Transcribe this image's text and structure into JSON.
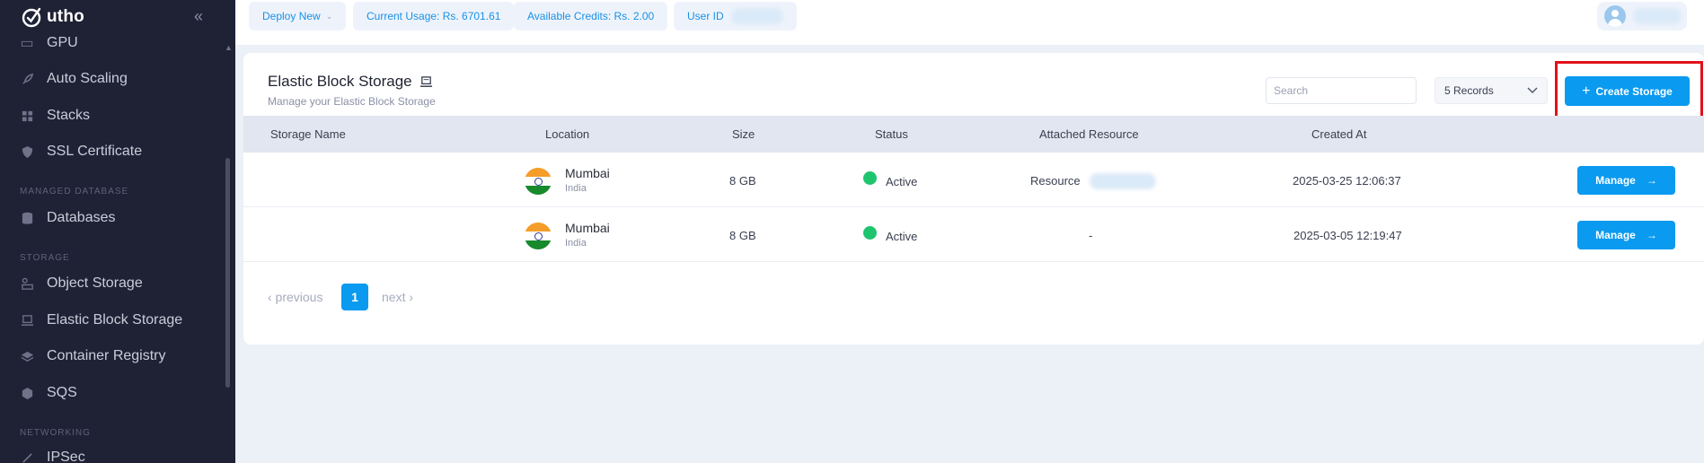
{
  "brand": {
    "name": "utho"
  },
  "sidebar": {
    "top_partial_label": "GPU",
    "items": [
      {
        "label": "Auto Scaling",
        "icon": "rocket-icon"
      },
      {
        "label": "Stacks",
        "icon": "stacks-icon"
      },
      {
        "label": "SSL Certificate",
        "icon": "shield-icon"
      },
      {
        "label": "Databases",
        "icon": "database-icon"
      },
      {
        "label": "Object Storage",
        "icon": "object-storage-icon"
      },
      {
        "label": "Elastic Block Storage",
        "icon": "block-storage-icon"
      },
      {
        "label": "Container Registry",
        "icon": "layers-icon"
      },
      {
        "label": "SQS",
        "icon": "queue-icon"
      },
      {
        "label": "IPSec",
        "icon": "link-icon"
      }
    ],
    "sections": {
      "managed_database": "MANAGED DATABASE",
      "storage": "STORAGE",
      "networking": "NETWORKING"
    }
  },
  "topbar": {
    "deploy_label": "Deploy New",
    "usage_label": "Current Usage: Rs. 6701.61",
    "credits_label": "Available Credits: Rs. 2.00",
    "user_id_label": "User ID"
  },
  "page": {
    "title": "Elastic Block Storage",
    "subtitle": "Manage your Elastic Block Storage",
    "search_placeholder": "Search",
    "records_label": "5 Records",
    "create_label": "Create Storage"
  },
  "table": {
    "headers": [
      "Storage Name",
      "Location",
      "Size",
      "Status",
      "Attached Resource",
      "Created At"
    ],
    "rows": [
      {
        "name": "",
        "city": "Mumbai",
        "country": "India",
        "size": "8 GB",
        "status": "Active",
        "resource": "Resource",
        "created": "2025-03-25 12:06:37",
        "action": "Manage"
      },
      {
        "name": "",
        "city": "Mumbai",
        "country": "India",
        "size": "8 GB",
        "status": "Active",
        "resource": "-",
        "created": "2025-03-05 12:19:47",
        "action": "Manage"
      }
    ]
  },
  "pagination": {
    "prev": "‹ previous",
    "current": "1",
    "next": "next ›"
  },
  "colors": {
    "accent": "#0a9af0",
    "sidebar_bg": "#1f2235",
    "status_active": "#1fc46e",
    "highlight": "#e3101a"
  }
}
